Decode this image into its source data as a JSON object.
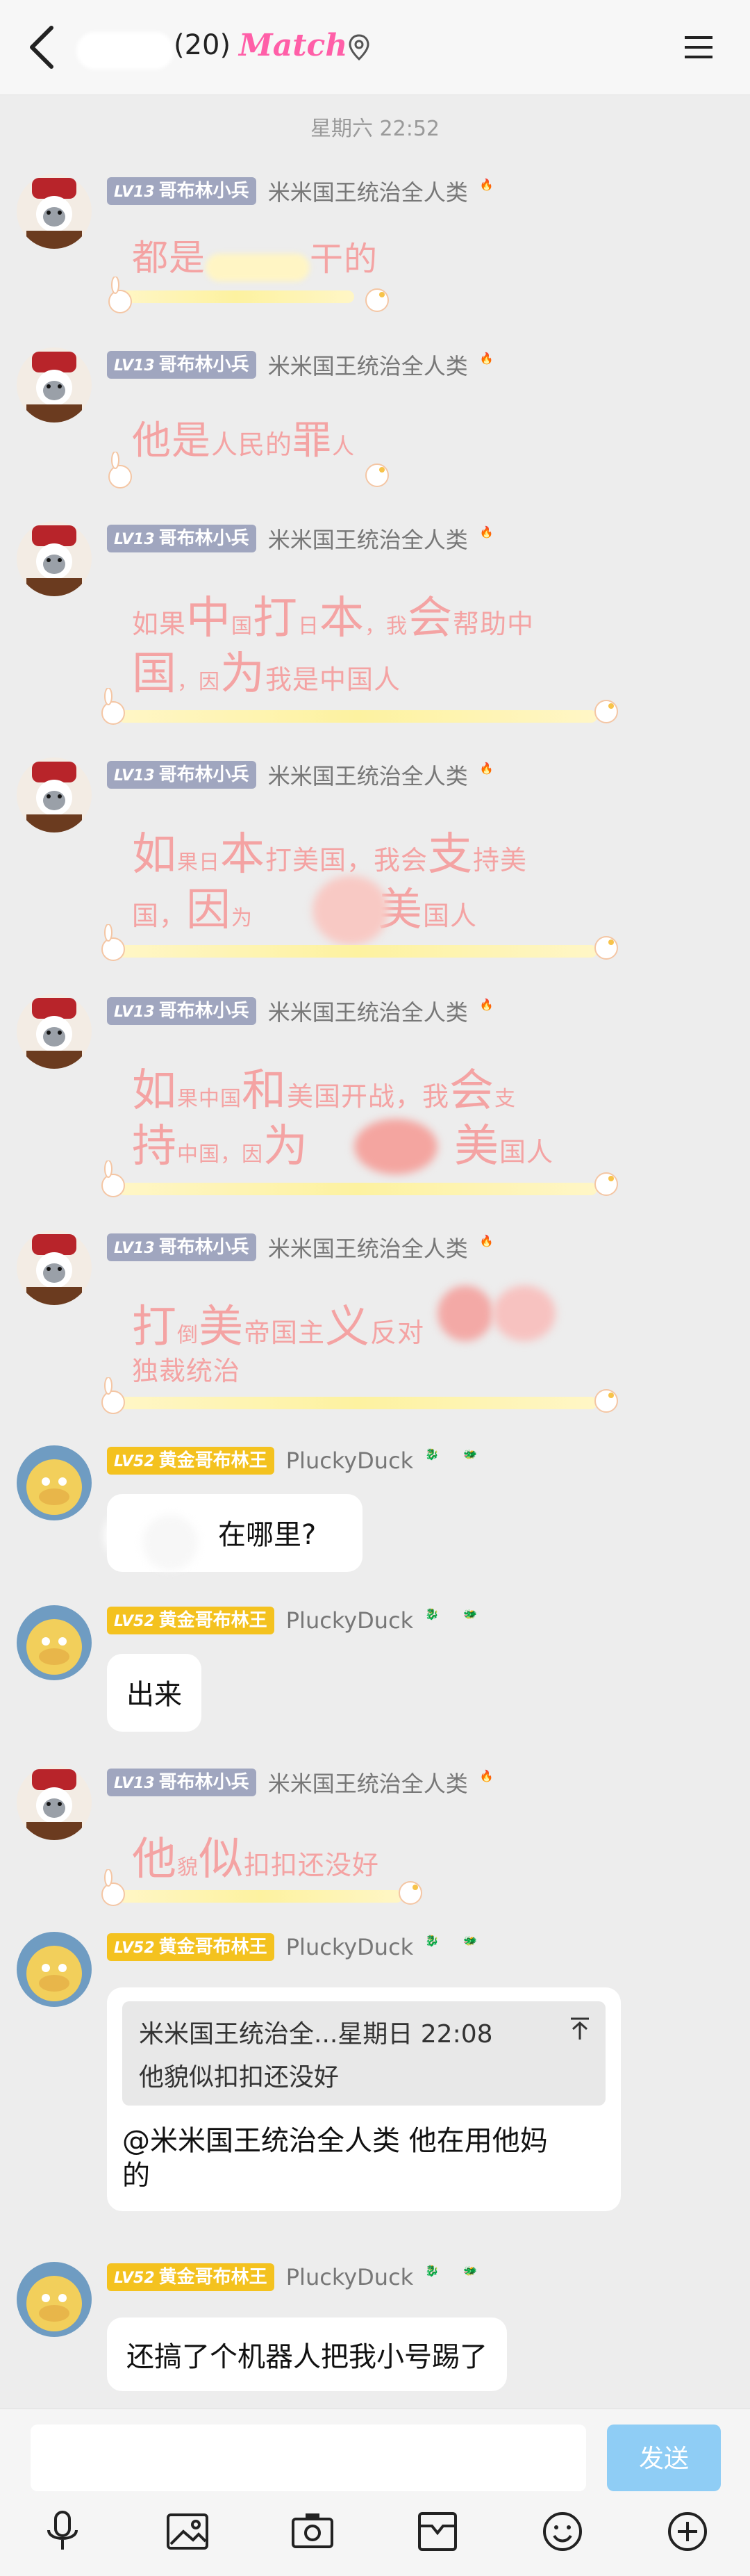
{
  "header": {
    "count": "(20)",
    "match_label": "Match"
  },
  "timestamp": "星期六 22:52",
  "users": {
    "goblin": {
      "level": "LV13",
      "title": "哥布林小兵",
      "name": "米米国王统治全人类"
    },
    "duck": {
      "level": "LV52",
      "title": "黄金哥布林王",
      "name": "PluckyDuck"
    }
  },
  "messages": {
    "m1": {
      "parts": [
        "都是",
        "干的"
      ]
    },
    "m2": {
      "parts": [
        "他是",
        "人民的",
        "罪",
        "人"
      ]
    },
    "m3": {
      "line1": [
        "如果",
        "中",
        "国",
        "打",
        "日",
        "本",
        "，我",
        "会",
        "帮助中"
      ],
      "line2": [
        "国",
        "，因",
        "为",
        "我是中国人"
      ]
    },
    "m4": {
      "line1": [
        "如",
        "果日",
        "本",
        "打美国，我会",
        "支",
        "持美"
      ],
      "line2": [
        "国，",
        "因",
        "为",
        "美",
        "国人"
      ]
    },
    "m5": {
      "line1": [
        "如",
        "果中国",
        "和",
        "美国开战，我",
        "会",
        "支"
      ],
      "line2": [
        "持",
        "中国，因",
        "为",
        "美",
        "国人"
      ]
    },
    "m6": {
      "line1": [
        "打",
        "倒",
        "美",
        "帝国主",
        "义",
        "反对"
      ],
      "line2": [
        "独裁统治"
      ]
    },
    "m7": {
      "text": "在哪里?"
    },
    "m8": {
      "text": "出来"
    },
    "m9": {
      "parts": [
        "他",
        "貌",
        "似",
        "扣扣还没好"
      ]
    },
    "m10": {
      "quote_head": "米米国王统治全...星期日 22:08",
      "quote_body": "他貌似扣扣还没好",
      "text_line1": "@米米国王统治全人类 他在用他妈",
      "text_line2": "的"
    },
    "m11": {
      "text": "还搞了个机器人把我小号踢了"
    }
  },
  "composer": {
    "placeholder": "",
    "send_label": "发送"
  },
  "toolbar": [
    "mic-icon",
    "image-icon",
    "camera-icon",
    "box-icon",
    "emoji-icon",
    "plus-icon"
  ],
  "colors": {
    "send": "#8fcdf5",
    "fancy_text": "#f4a3a3",
    "level_gold": "#f4c21f",
    "level_gray": "#a0a6bf"
  }
}
